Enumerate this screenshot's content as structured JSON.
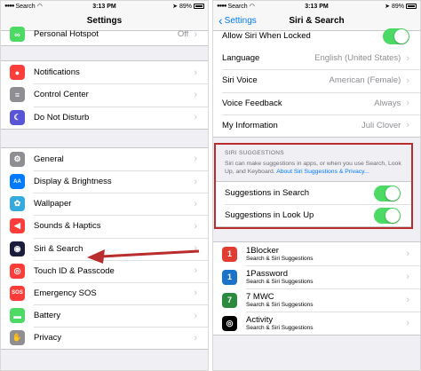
{
  "left": {
    "status": {
      "carrier": "Search",
      "time": "3:13 PM",
      "battery": "89%"
    },
    "title": "Settings",
    "partial_row": {
      "label": "Personal Hotspot",
      "value": "Off"
    },
    "group1": [
      {
        "label": "Notifications",
        "icon": "bell-icon",
        "color": "#fc3d39",
        "glyph": "●"
      },
      {
        "label": "Control Center",
        "icon": "sliders-icon",
        "color": "#8e8e93",
        "glyph": "≡"
      },
      {
        "label": "Do Not Disturb",
        "icon": "moon-icon",
        "color": "#5856d6",
        "glyph": "☾"
      }
    ],
    "group2": [
      {
        "label": "General",
        "icon": "gear-icon",
        "color": "#8e8e93",
        "glyph": "⚙"
      },
      {
        "label": "Display & Brightness",
        "icon": "text-size-icon",
        "color": "#007aff",
        "glyph": "AA"
      },
      {
        "label": "Wallpaper",
        "icon": "flower-icon",
        "color": "#35aadc",
        "glyph": "✿"
      },
      {
        "label": "Sounds & Haptics",
        "icon": "speaker-icon",
        "color": "#fc3d39",
        "glyph": "◀"
      },
      {
        "label": "Siri & Search",
        "icon": "siri-icon",
        "color": "#1c1c3c",
        "glyph": "◉"
      },
      {
        "label": "Touch ID & Passcode",
        "icon": "fingerprint-icon",
        "color": "#fc3d39",
        "glyph": "◎"
      },
      {
        "label": "Emergency SOS",
        "icon": "sos-icon",
        "color": "#fc3d39",
        "glyph": "SOS"
      },
      {
        "label": "Battery",
        "icon": "battery-icon",
        "color": "#4cd964",
        "glyph": "▬"
      },
      {
        "label": "Privacy",
        "icon": "hand-icon",
        "color": "#8e8e93",
        "glyph": "✋"
      }
    ]
  },
  "right": {
    "status": {
      "carrier": "Search",
      "time": "3:13 PM",
      "battery": "89%"
    },
    "back_label": "Settings",
    "title": "Siri & Search",
    "partial_row": {
      "label": "Allow Siri When Locked"
    },
    "rows": [
      {
        "label": "Language",
        "value": "English (United States)"
      },
      {
        "label": "Siri Voice",
        "value": "American (Female)"
      },
      {
        "label": "Voice Feedback",
        "value": "Always"
      },
      {
        "label": "My Information",
        "value": "Juli Clover"
      }
    ],
    "suggestions": {
      "header": "SIRI SUGGESTIONS",
      "footer": "Siri can make suggestions in apps, or when you use Search, Look Up, and Keyboard.",
      "footer_link": "About Siri Suggestions & Privacy...",
      "toggles": [
        {
          "label": "Suggestions in Search",
          "on": true
        },
        {
          "label": "Suggestions in Look Up",
          "on": true
        }
      ]
    },
    "apps": [
      {
        "name": "1Blocker",
        "sub": "Search & Siri Suggestions",
        "icon": "1blocker-icon",
        "color": "#e03c31",
        "glyph": "1"
      },
      {
        "name": "1Password",
        "sub": "Search & Siri Suggestions",
        "icon": "1password-icon",
        "color": "#1a73c9",
        "glyph": "1"
      },
      {
        "name": "7 MWC",
        "sub": "Search & Siri Suggestions",
        "icon": "7mwc-icon",
        "color": "#2b8a3e",
        "glyph": "7"
      },
      {
        "name": "Activity",
        "sub": "Search & Siri Suggestions",
        "icon": "activity-rings-icon",
        "color": "#000000",
        "glyph": "◎"
      }
    ]
  },
  "accent": {
    "toggle_on": "#4cd964",
    "link": "#007aff",
    "highlight": "#b92d2d"
  }
}
